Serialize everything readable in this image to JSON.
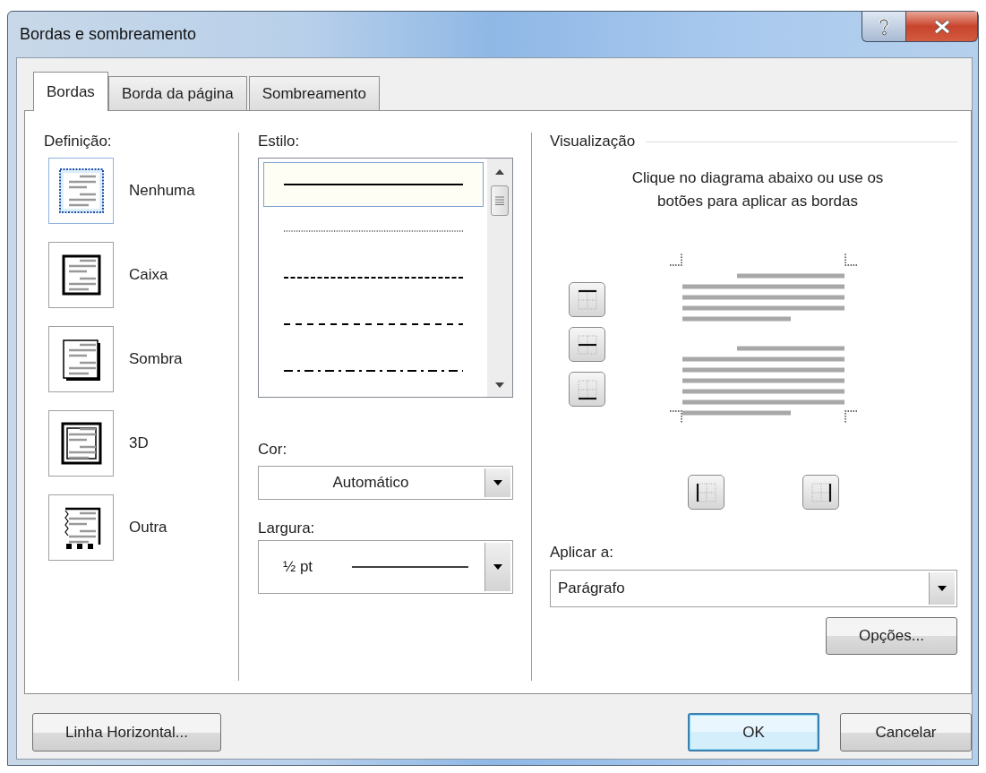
{
  "window": {
    "title": "Bordas e sombreamento"
  },
  "tabs": [
    {
      "label": "Bordas",
      "selected": true
    },
    {
      "label": "Borda da página",
      "selected": false
    },
    {
      "label": "Sombreamento",
      "selected": false
    }
  ],
  "definition": {
    "label": "Definição:",
    "settings": [
      {
        "label": "Nenhuma",
        "kind": "none",
        "selected": true
      },
      {
        "label": "Caixa",
        "kind": "box",
        "selected": false
      },
      {
        "label": "Sombra",
        "kind": "shadow",
        "selected": false
      },
      {
        "label": "3D",
        "kind": "double",
        "selected": false
      },
      {
        "label": "Outra",
        "kind": "custom",
        "selected": false
      }
    ]
  },
  "style": {
    "label": "Estilo:",
    "options": [
      {
        "kind": "solid",
        "selected": true
      },
      {
        "kind": "dotted",
        "selected": false
      },
      {
        "kind": "dashed",
        "selected": false
      },
      {
        "kind": "dashed-wide",
        "selected": false
      },
      {
        "kind": "dash-dot",
        "selected": false
      }
    ]
  },
  "color": {
    "label": "Cor:",
    "value": "Automático"
  },
  "width": {
    "label": "Largura:",
    "value": "½ pt"
  },
  "preview": {
    "title": "Visualização",
    "instructions": "Clique no diagrama abaixo ou use os botões para aplicar as bordas",
    "side_buttons": [
      {
        "kind": "top"
      },
      {
        "kind": "middle"
      },
      {
        "kind": "bottom"
      }
    ],
    "bottom_buttons": [
      {
        "kind": "left"
      },
      {
        "kind": "right"
      }
    ]
  },
  "apply_to": {
    "label": "Aplicar a:",
    "value": "Parágrafo"
  },
  "options_button": "Opções...",
  "footer": [
    {
      "label": "Linha Horizontal...",
      "default": false
    },
    {
      "label": "OK",
      "default": true
    },
    {
      "label": "Cancelar",
      "default": false
    }
  ]
}
